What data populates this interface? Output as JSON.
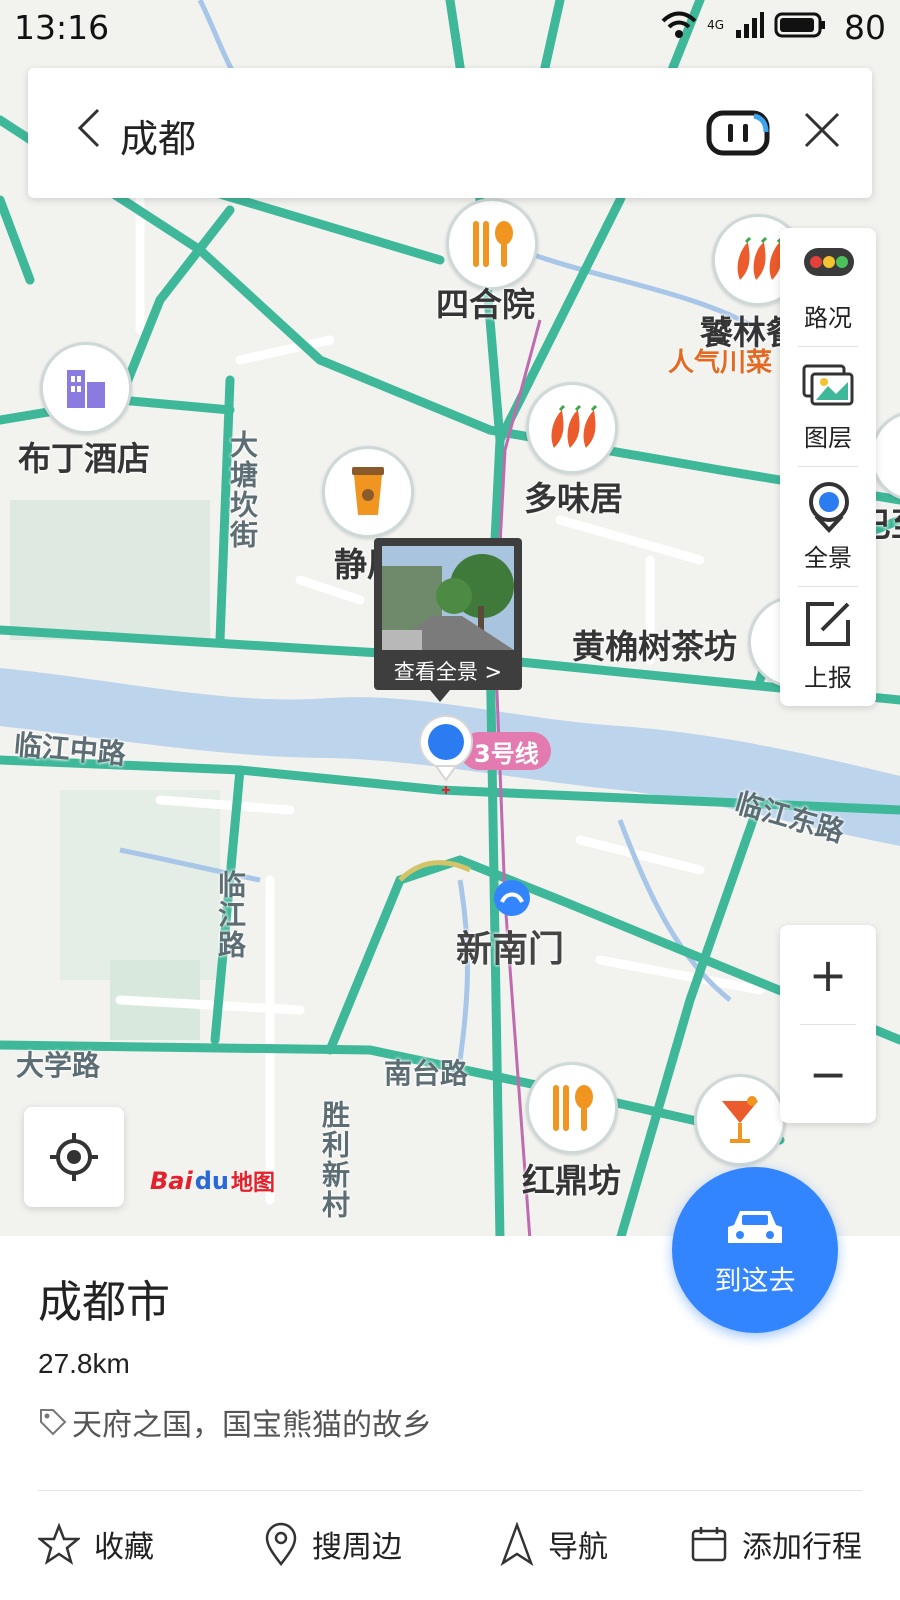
{
  "status_bar": {
    "time": "13:16",
    "network": "4G",
    "battery": "80"
  },
  "search": {
    "query": "成都"
  },
  "map": {
    "pois": [
      {
        "name": "四合院",
        "icon": "restaurant-icon"
      },
      {
        "name": "饕林餐",
        "icon": "sichuan-food-icon",
        "subtitle": "人气川菜"
      },
      {
        "name": "布丁酒店",
        "icon": "hotel-icon"
      },
      {
        "name": "多味居",
        "icon": "sichuan-food-icon"
      },
      {
        "name": "静居",
        "icon": "coffee-icon"
      },
      {
        "name": "黄桷树茶坊",
        "icon": "tea-icon"
      },
      {
        "name": "红鼎坊",
        "icon": "restaurant-icon"
      },
      {
        "name": "巴至",
        "icon": "food-icon"
      }
    ],
    "roads": [
      "大塘坎街",
      "临江中路",
      "临江东路",
      "临江路",
      "大学路",
      "南台路",
      "胜利新村"
    ],
    "area": "新南门",
    "metro_line": "3号线",
    "panorama_caption": "查看全景 >",
    "logo": "Baidu地图",
    "colors": {
      "road": "#3fb89a",
      "river": "#bcd4ec",
      "metro": "#e47bb0",
      "accent": "#3385ff"
    }
  },
  "tools": [
    {
      "label": "路况",
      "icon": "traffic-icon"
    },
    {
      "label": "图层",
      "icon": "layers-icon"
    },
    {
      "label": "全景",
      "icon": "panorama-icon"
    },
    {
      "label": "上报",
      "icon": "report-icon"
    }
  ],
  "zoom": {
    "in": "+",
    "out": "−"
  },
  "place": {
    "name": "成都市",
    "distance": "27.8km",
    "tagline": "天府之国，国宝熊猫的故乡"
  },
  "go_button": {
    "label": "到这去"
  },
  "actions": [
    {
      "label": "收藏",
      "icon": "star-icon"
    },
    {
      "label": "搜周边",
      "icon": "location-pin-icon"
    },
    {
      "label": "导航",
      "icon": "navigation-icon"
    },
    {
      "label": "添加行程",
      "icon": "calendar-icon"
    }
  ]
}
